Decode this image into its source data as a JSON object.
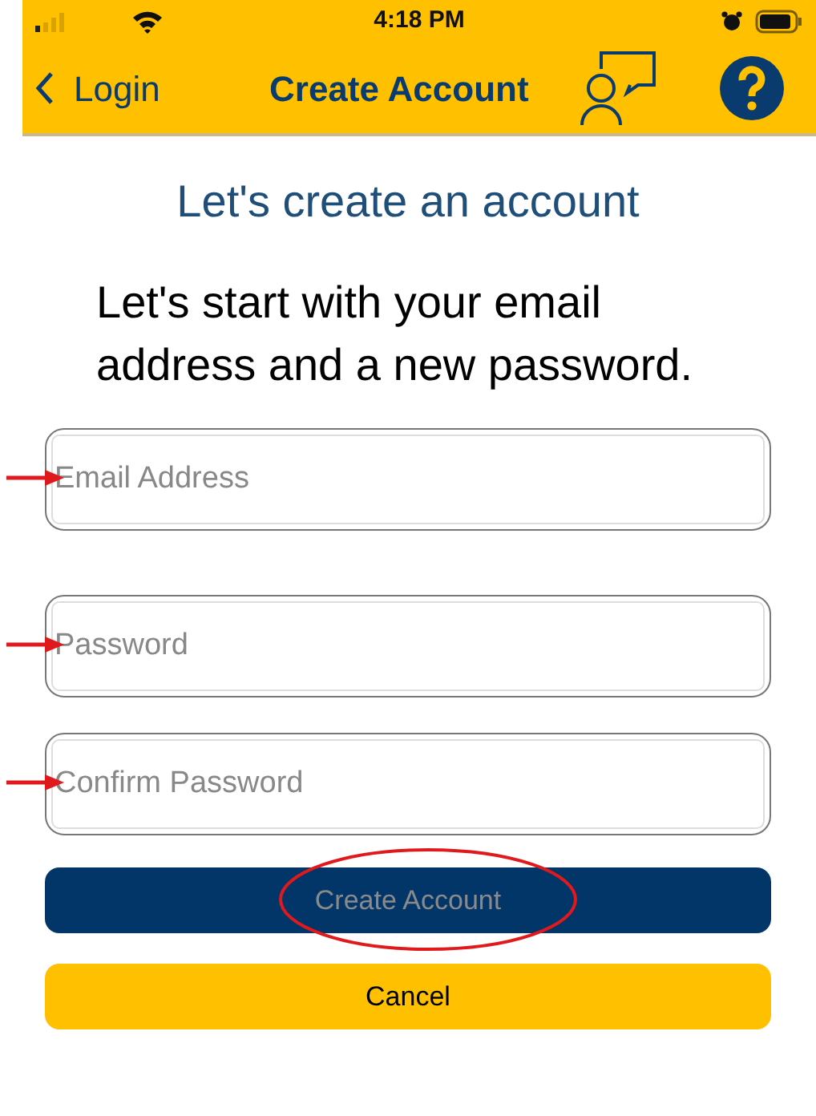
{
  "status_bar": {
    "time": "4:18 PM"
  },
  "nav_bar": {
    "back_label": "Login",
    "title": "Create Account"
  },
  "heading": "Let's create an account",
  "intro": "Let's start with your email address and a new password.",
  "fields": [
    {
      "placeholder": "Email Address",
      "annotated": true
    },
    {
      "placeholder": "Password",
      "annotated": true
    },
    {
      "placeholder": "Confirm Password",
      "annotated": true
    }
  ],
  "buttons": [
    {
      "label": "Create Account",
      "kind": "primary",
      "disabled": true,
      "circled": true
    },
    {
      "label": "Cancel",
      "kind": "secondary",
      "disabled": false,
      "circled": false
    }
  ]
}
